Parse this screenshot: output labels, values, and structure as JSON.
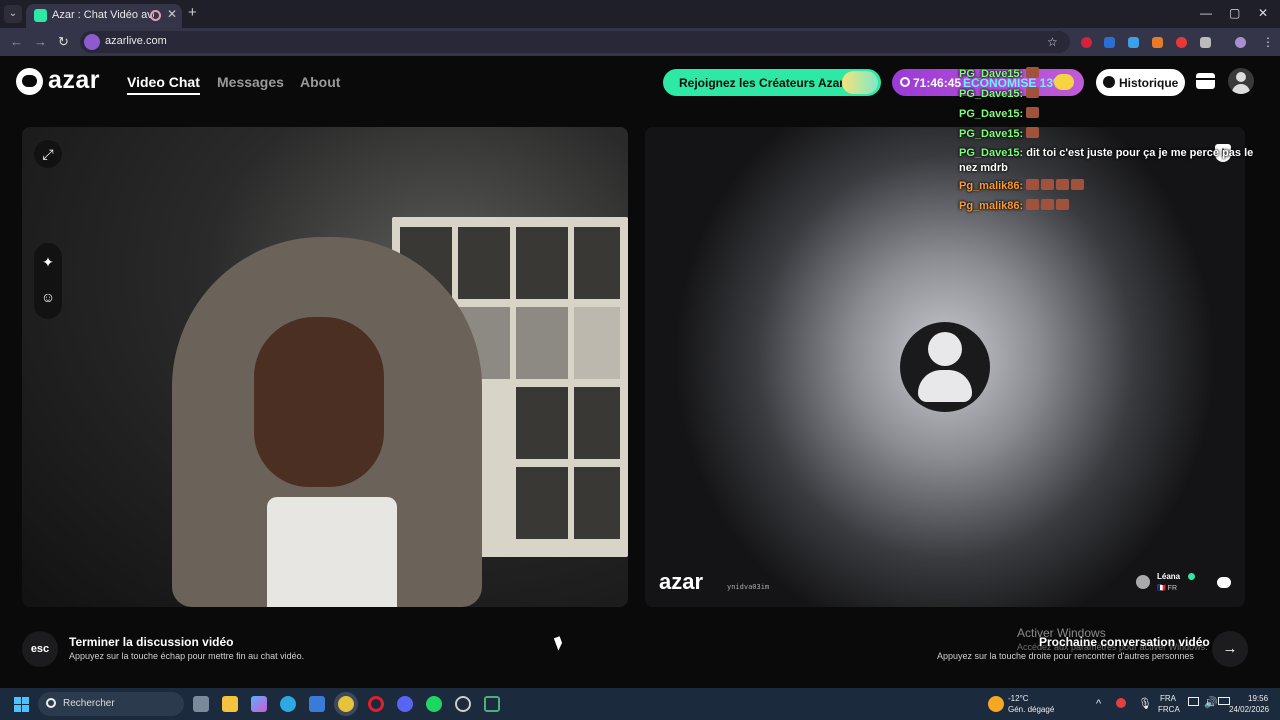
{
  "browser": {
    "tab_title": "Azar : Chat Vidéo avec de r",
    "tab_close": "✕",
    "new_tab": "+",
    "url": "azarlive.com",
    "window_controls": [
      "—",
      "▢",
      "✕"
    ]
  },
  "site": {
    "logo_text": "azar",
    "nav": [
      "Video Chat",
      "Messages",
      "About"
    ],
    "promo_label": "Rejoignez les Créateurs Azar",
    "timer_value": "71:46:45",
    "timer_label": "ÉCONOMISÉ 13%",
    "history_label": "Historique"
  },
  "chat_overlay": [
    {
      "user": "PG_Dave15:",
      "text": "",
      "user_color": "green"
    },
    {
      "user": "PG_Dave15:",
      "text": "",
      "user_color": "green"
    },
    {
      "user": "PG_Dave15:",
      "text": "",
      "user_color": "green"
    },
    {
      "user": "PG_Dave15:",
      "text": "",
      "user_color": "green"
    },
    {
      "user": "PG_Dave15:",
      "text": "dit toi c'est juste pour ça je me perce pas le nez mdrb",
      "user_color": "green"
    },
    {
      "user": "Pg_malik86:",
      "text": "",
      "user_color": "orange"
    },
    {
      "user": "Pg_malik86:",
      "text": "",
      "user_color": "orange"
    }
  ],
  "video": {
    "remote_logo": "azar",
    "remote_id": "ynidva03im",
    "remote_user": "Léana",
    "remote_country": "FR"
  },
  "footer": {
    "esc_key": "esc",
    "end_title": "Terminer la discussion vidéo",
    "end_sub": "Appuyez sur la touche échap pour mettre fin au chat vidéo.",
    "next_title": "Prochaine conversation vidéo",
    "next_sub": "Appuyez sur la touche droite pour rencontrer d'autres personnes",
    "next_arrow": "→",
    "activate_title": "Activer Windows",
    "activate_sub": "Accédez aux paramètres pour activer Windows."
  },
  "taskbar": {
    "search_placeholder": "Rechercher",
    "weather_temp": "-12°C",
    "weather_desc": "Gén. dégagé",
    "lang_1": "FRA",
    "lang_2": "FRCA",
    "time": "19:56",
    "date": "24/02/2026"
  },
  "colors": {
    "accent_green": "#2ee8a5",
    "timer_purple": "#9b3bd6",
    "chat_user_green": "#7cff7a",
    "chat_user_orange": "#ff9a2e"
  }
}
